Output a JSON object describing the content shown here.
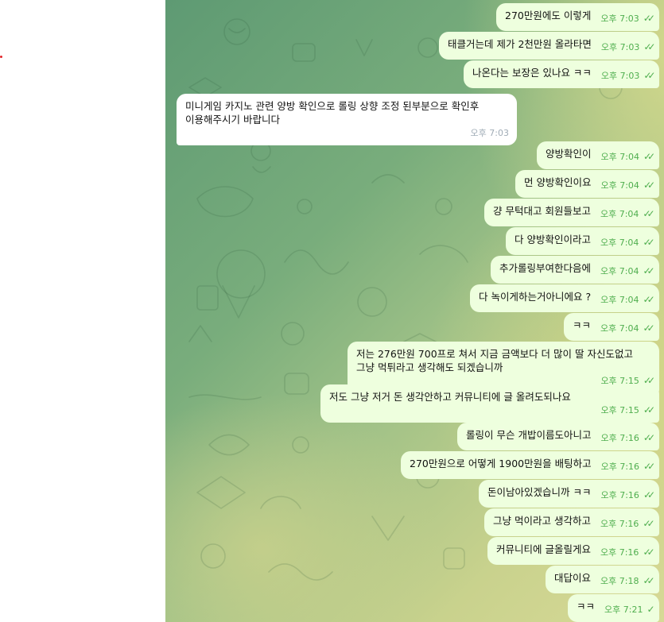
{
  "messages": [
    {
      "text": "270만원에도 이렇게",
      "time": "오후 7:03",
      "ticks": "✓✓"
    },
    {
      "text": "태클거는데 제가 2천만원 올라타면",
      "time": "오후 7:03",
      "ticks": "✓✓"
    },
    {
      "text": "나온다는 보장은 있나요 ㅋㅋ",
      "time": "오후 7:03",
      "ticks": "✓✓"
    },
    {
      "lines": [
        "미니게임 카지노 관련 양방 확인으로 롤링 상향 조정 된부분으로 확인후",
        "이용해주시기 바랍니다"
      ],
      "time": "오후 7:03"
    },
    {
      "text": "양방확인이",
      "time": "오후 7:04",
      "ticks": "✓✓"
    },
    {
      "text": "먼 양방확인이요",
      "time": "오후 7:04",
      "ticks": "✓✓"
    },
    {
      "text": "걍 무턱대고 회원들보고",
      "time": "오후 7:04",
      "ticks": "✓✓"
    },
    {
      "text": "다 양방확인이라고",
      "time": "오후 7:04",
      "ticks": "✓✓"
    },
    {
      "text": "추가롤링부여한다음에",
      "time": "오후 7:04",
      "ticks": "✓✓"
    },
    {
      "text": "다 녹이게하는거아니에요 ?",
      "time": "오후 7:04",
      "ticks": "✓✓"
    },
    {
      "text": "ㅋㅋ",
      "time": "오후 7:04",
      "ticks": "✓✓"
    },
    {
      "lines": [
        "저는 276만원 700프로 쳐서 지금 금액보다 더 많이 딸 자신도없고",
        "그냥 먹튀라고 생각해도 되겠습니까"
      ],
      "time": "오후 7:15",
      "ticks": "✓✓"
    },
    {
      "lines": [
        "저도 그냥 저거 돈 생각안하고 커뮤니티에 글 올려도되나요"
      ],
      "time": "오후 7:15",
      "ticks": "✓✓"
    },
    {
      "text": "롤링이 무슨 개밥이름도아니고",
      "time": "오후 7:16",
      "ticks": "✓✓"
    },
    {
      "text": "270만원으로 어떻게 1900만원을 배팅하고",
      "time": "오후 7:16",
      "ticks": "✓✓"
    },
    {
      "text": "돈이남아있겠습니까 ㅋㅋ",
      "time": "오후 7:16",
      "ticks": "✓✓"
    },
    {
      "text": "그냥 먹이라고 생각하고",
      "time": "오후 7:16",
      "ticks": "✓✓"
    },
    {
      "text": "커뮤니티에 글올릴게요",
      "time": "오후 7:16",
      "ticks": "✓✓"
    },
    {
      "text": "대답이요",
      "time": "오후 7:18",
      "ticks": "✓✓"
    },
    {
      "text": "ㅋㅋ",
      "time": "오후 7:21",
      "ticks": "✓"
    }
  ]
}
